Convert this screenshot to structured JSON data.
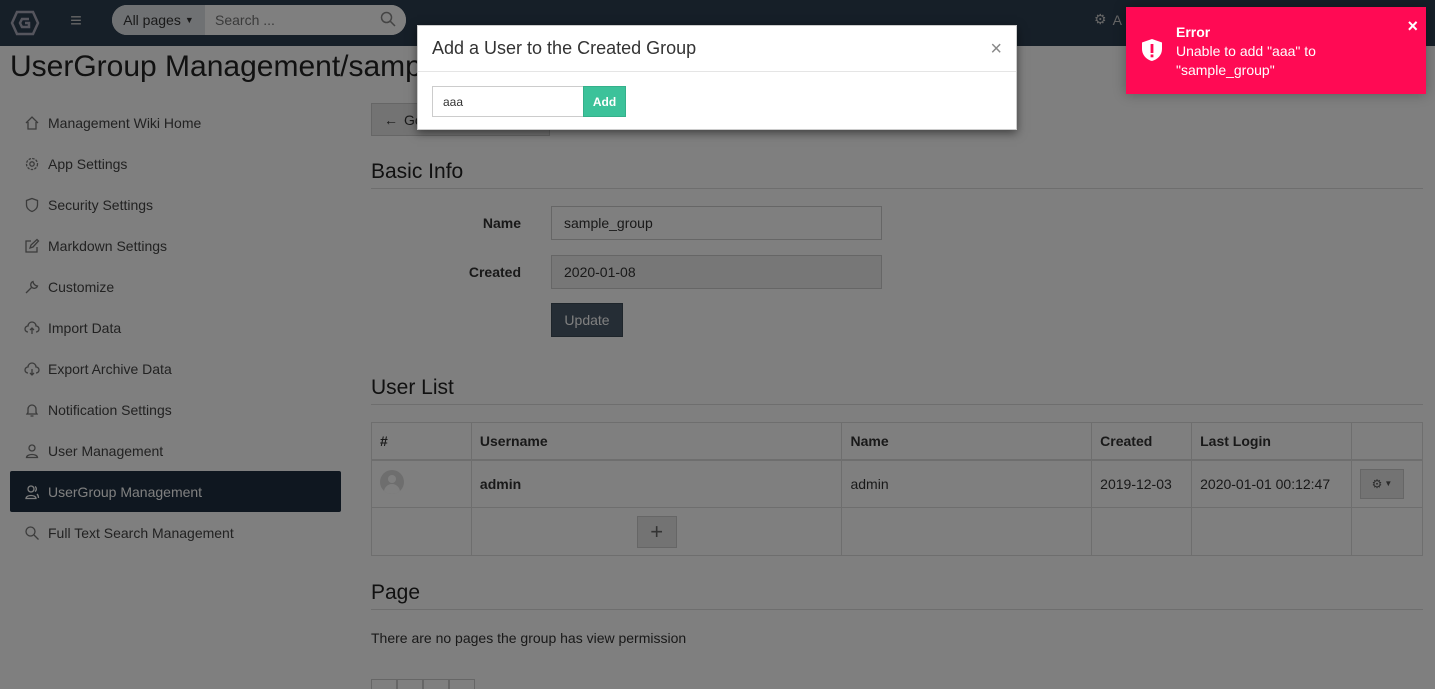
{
  "navbar": {
    "scope_label": "All pages",
    "search_placeholder": "Search ...",
    "admin_label": "A"
  },
  "page": {
    "title": "UserGroup Management/sample_"
  },
  "sidebar": {
    "items": [
      {
        "label": "Management Wiki Home",
        "icon": "home-icon"
      },
      {
        "label": "App Settings",
        "icon": "gear-icon"
      },
      {
        "label": "Security Settings",
        "icon": "shield-icon"
      },
      {
        "label": "Markdown Settings",
        "icon": "edit-icon"
      },
      {
        "label": "Customize",
        "icon": "wrench-icon"
      },
      {
        "label": "Import Data",
        "icon": "cloud-upload-icon"
      },
      {
        "label": "Export Archive Data",
        "icon": "cloud-download-icon"
      },
      {
        "label": "Notification Settings",
        "icon": "bell-icon"
      },
      {
        "label": "User Management",
        "icon": "user-icon"
      },
      {
        "label": "UserGroup Management",
        "icon": "users-icon",
        "active": true
      },
      {
        "label": "Full Text Search Management",
        "icon": "search-icon"
      }
    ]
  },
  "main": {
    "goback_label": "Go",
    "basic_info": {
      "title": "Basic Info",
      "name_label": "Name",
      "name_value": "sample_group",
      "created_label": "Created",
      "created_value": "2020-01-08",
      "update_label": "Update"
    },
    "user_list": {
      "title": "User List",
      "columns": [
        "#",
        "Username",
        "Name",
        "Created",
        "Last Login"
      ],
      "rows": [
        {
          "username": "admin",
          "name": "admin",
          "created": "2019-12-03",
          "last_login": "2020-01-01 00:12:47"
        }
      ],
      "add_symbol": "+"
    },
    "page_section": {
      "title": "Page",
      "empty_text": "There are no pages the group has view permission"
    }
  },
  "modal": {
    "title": "Add a User to the Created Group",
    "close_symbol": "×",
    "input_value": "aaa",
    "add_label": "Add"
  },
  "toast": {
    "title": "Error",
    "message": "Unable to add \"aaa\" to \"sample_group\"",
    "close_symbol": "×",
    "color": "#ff0a54"
  }
}
